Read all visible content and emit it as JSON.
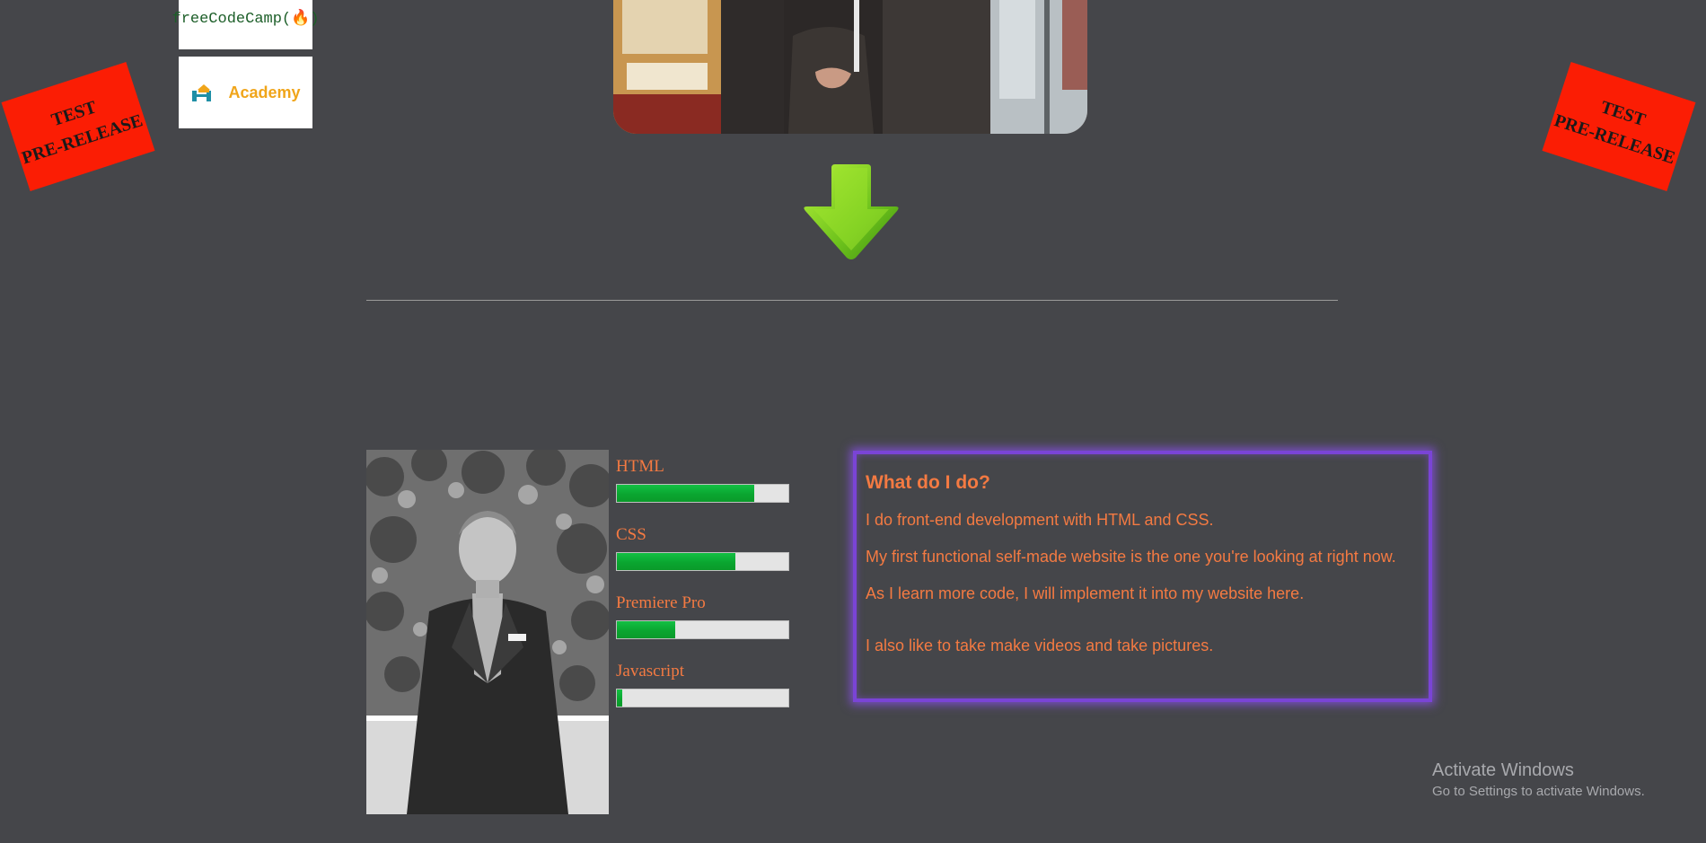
{
  "stamps": {
    "left": {
      "line1": "TEST",
      "line2": "PRE-RELEASE"
    },
    "right": {
      "line1": "TEST",
      "line2": "PRE-RELEASE"
    },
    "color": "#fb1d04"
  },
  "logos": {
    "freecodecamp": "freeCodeCamp(🔥)",
    "academy": "Academy"
  },
  "skills": [
    {
      "name": "HTML",
      "level": 0.8
    },
    {
      "name": "CSS",
      "level": 0.69
    },
    {
      "name": "Premiere Pro",
      "level": 0.34
    },
    {
      "name": "Javascript",
      "level": 0.03
    }
  ],
  "about": {
    "heading": "What do I do?",
    "line1": "I do front-end development with HTML and CSS.",
    "line2": "My first functional self-made website is the one you're looking at right now.",
    "line3": "As I learn more code, I will implement it into my website here.",
    "line4": "I also like to take make videos and take pictures."
  },
  "watermark": {
    "title": "Activate Windows",
    "subtitle": "Go to Settings to activate Windows."
  },
  "colors": {
    "background": "#45464a",
    "accent_text": "#f47a42",
    "box_glow": "#7a44d6",
    "skill_fill": "#0aa630"
  },
  "icons": {
    "scroll_arrow": "arrow-down-icon"
  }
}
